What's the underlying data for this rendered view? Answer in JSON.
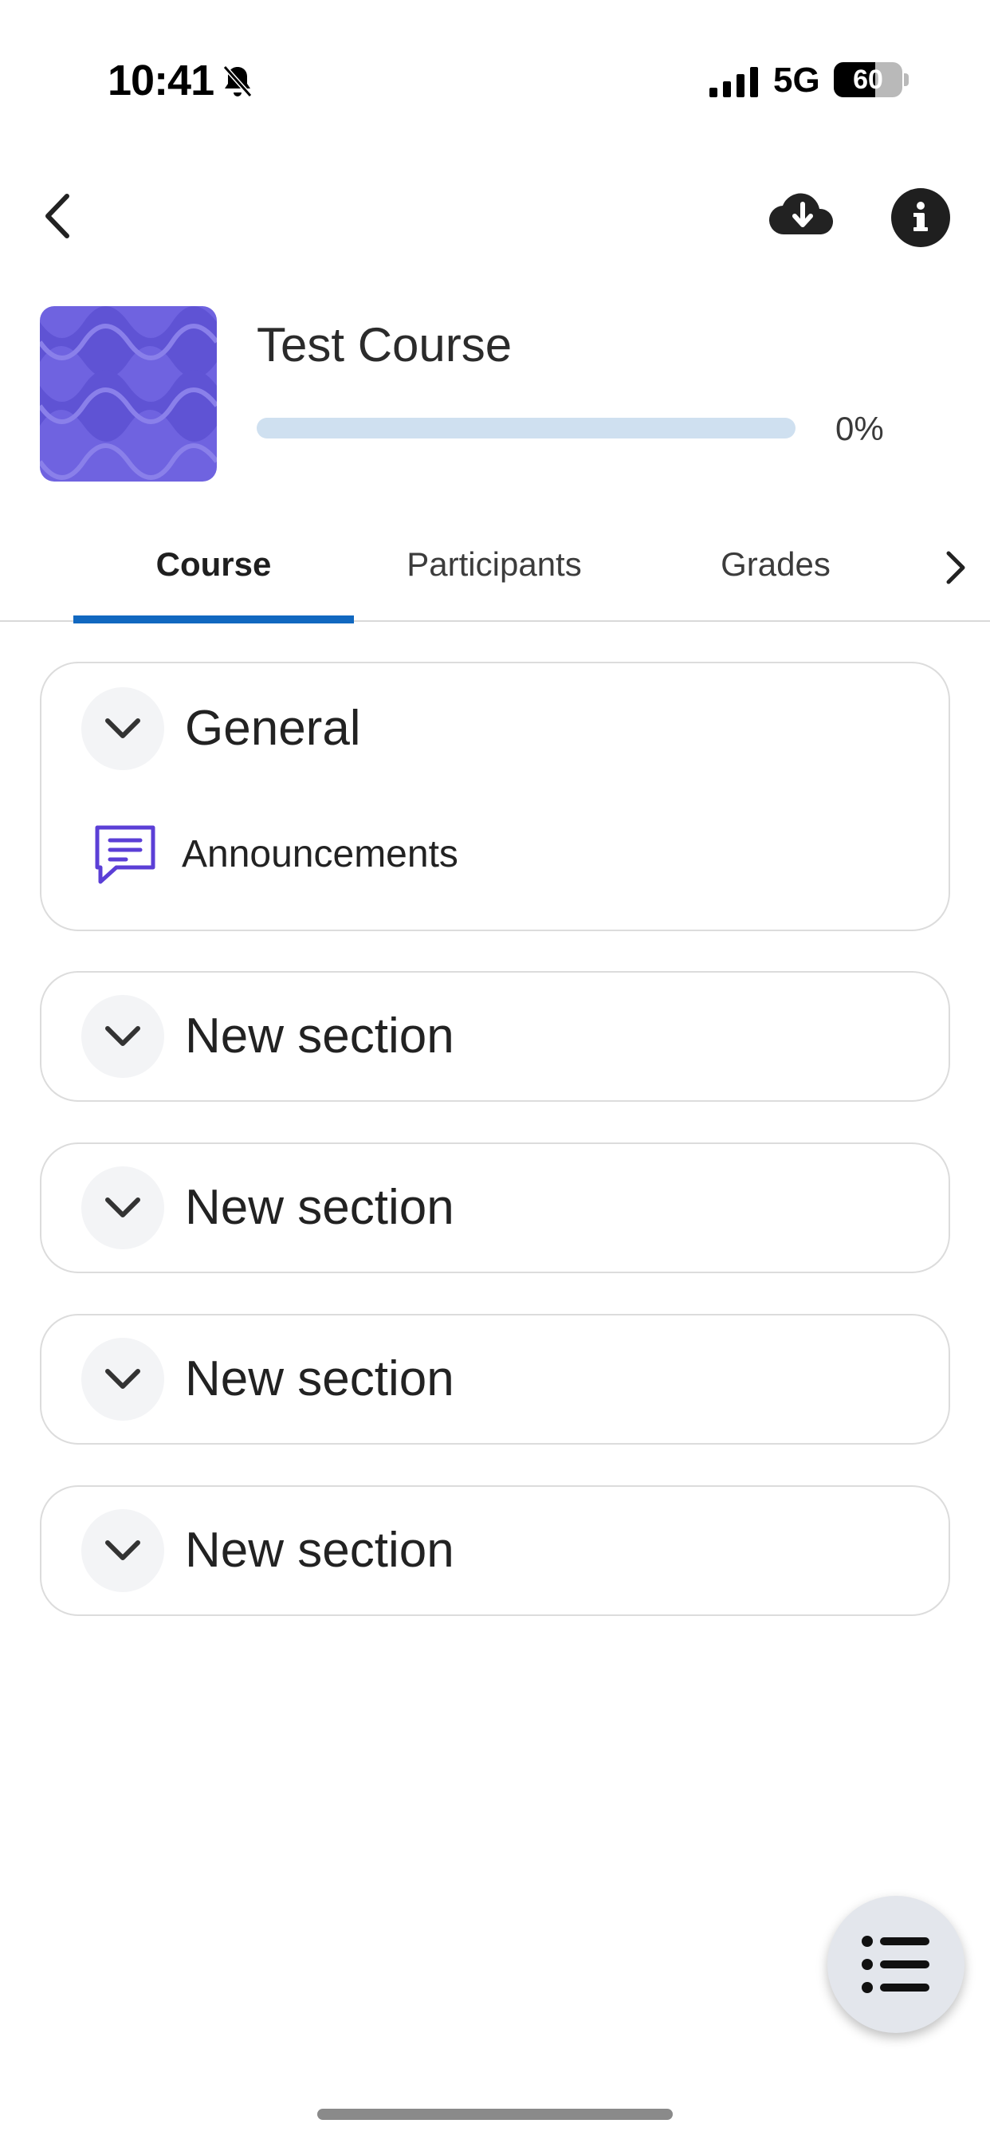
{
  "status_bar": {
    "time": "10:41",
    "network": "5G",
    "battery_percent": "60",
    "battery_level": 0.6
  },
  "toolbar": {
    "back_icon": "chevron-left-icon",
    "download_icon": "cloud-download-icon",
    "info_icon": "info-icon"
  },
  "course": {
    "title": "Test Course",
    "progress_label": "0%",
    "progress_value": 0
  },
  "tabs": [
    {
      "label": "Course",
      "active": true
    },
    {
      "label": "Participants",
      "active": false
    },
    {
      "label": "Grades",
      "active": false
    }
  ],
  "sections": [
    {
      "title": "General",
      "activities": [
        {
          "label": "Announcements",
          "icon": "forum-icon"
        }
      ]
    },
    {
      "title": "New section",
      "activities": []
    },
    {
      "title": "New section",
      "activities": []
    },
    {
      "title": "New section",
      "activities": []
    },
    {
      "title": "New section",
      "activities": []
    }
  ],
  "colors": {
    "accent": "#1168c0",
    "progress_track": "#cfe0f0",
    "course_image": "#6f63e0",
    "activity_icon": "#5b3fd6"
  },
  "fab": {
    "icon": "course-index-list-icon"
  }
}
